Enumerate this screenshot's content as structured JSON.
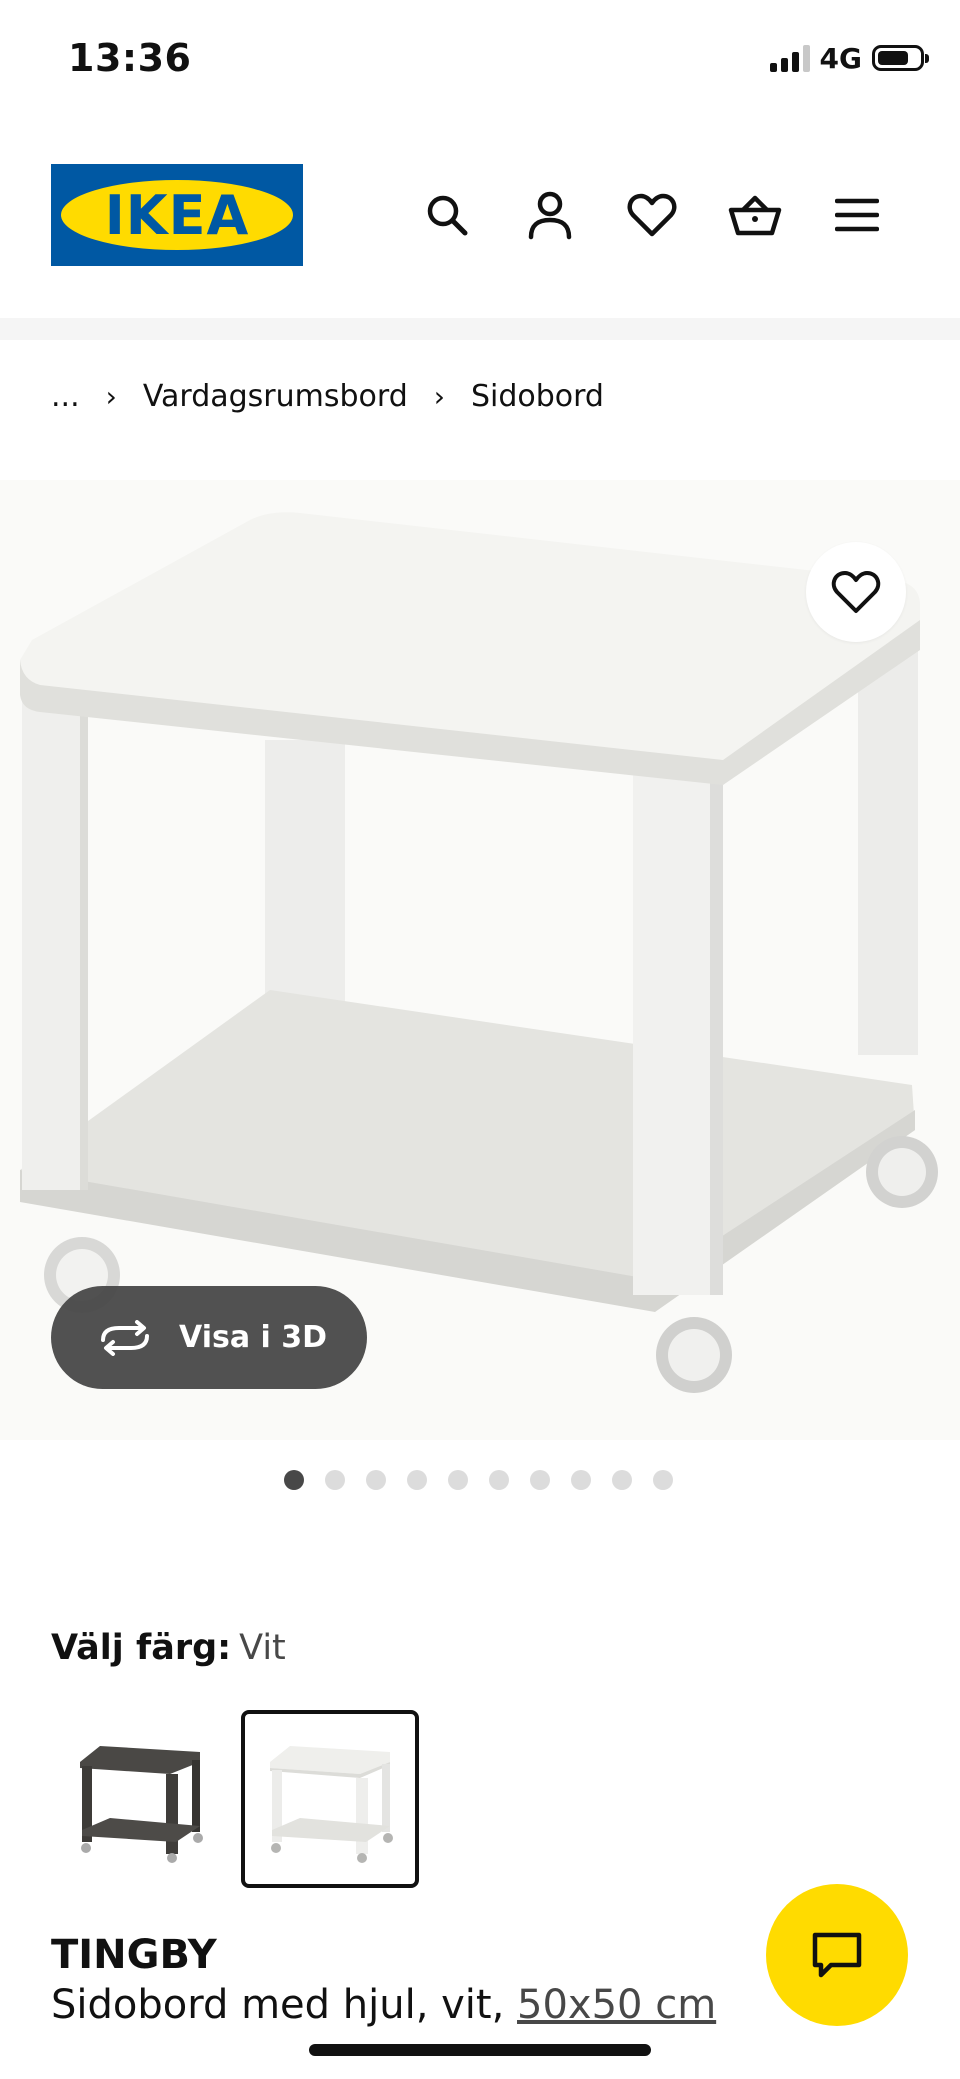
{
  "status_bar": {
    "time": "13:36",
    "network": "4G",
    "battery_level": 0.75
  },
  "header": {
    "logo_text": "IKEA",
    "icons": [
      "search-icon",
      "account-icon",
      "heart-icon",
      "cart-icon",
      "menu-icon"
    ]
  },
  "breadcrumb": {
    "ellipsis": "...",
    "items": [
      "Vardagsrumsbord",
      "Sidobord"
    ]
  },
  "gallery": {
    "view_3d_label": "Visa i 3D",
    "image_count": 10,
    "active_index": 0
  },
  "color_selector": {
    "label": "Välj färg:",
    "selected": "Vit",
    "options": [
      "swatch-dark",
      "swatch-white"
    ]
  },
  "product": {
    "name": "TINGBY",
    "description": "Sidobord med hjul, vit, ",
    "size": "50x50 cm"
  },
  "colors": {
    "ikea_blue": "#0058a3",
    "ikea_yellow": "#ffdb00"
  }
}
